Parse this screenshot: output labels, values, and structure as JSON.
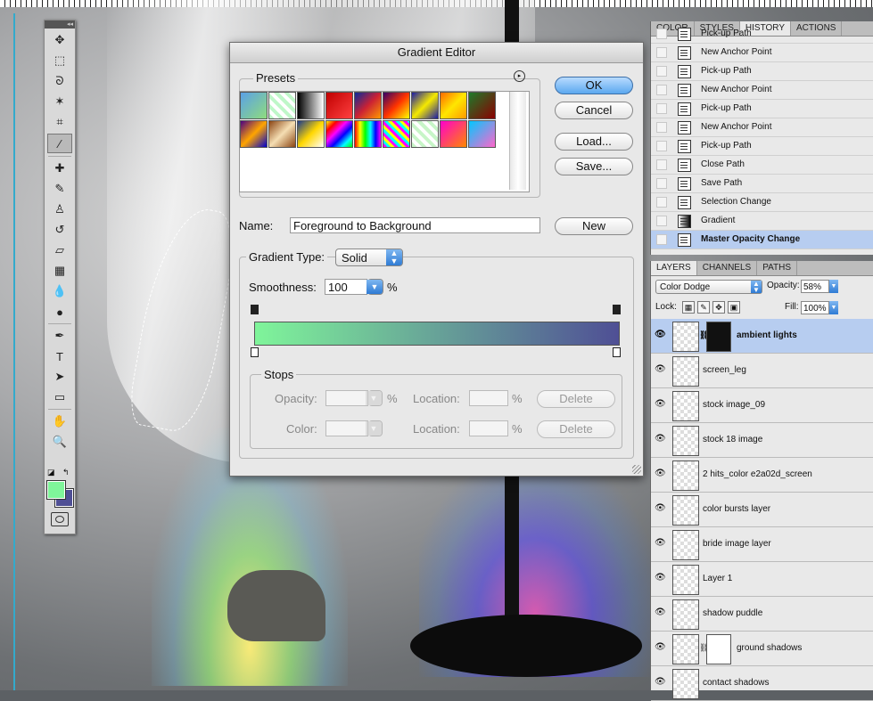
{
  "dialog": {
    "title": "Gradient Editor",
    "presets_label": "Presets",
    "ok": "OK",
    "cancel": "Cancel",
    "load": "Load...",
    "save": "Save...",
    "name_label": "Name:",
    "name_value": "Foreground to Background",
    "new": "New",
    "gradient_type_label": "Gradient Type:",
    "gradient_type_value": "Solid",
    "smoothness_label": "Smoothness:",
    "smoothness_value": "100",
    "percent": "%",
    "stops_label": "Stops",
    "opacity_label": "Opacity:",
    "location_label": "Location:",
    "color_label": "Color:",
    "delete": "Delete",
    "gradient_start": "#7ff59a",
    "gradient_end": "#4f4f95"
  },
  "presets": [
    "linear-gradient(135deg,#5aa0e6,#8fdc7e)",
    "repeating-linear-gradient(45deg,#bff7c9 0 4px,#fff 4px 8px)",
    "linear-gradient(90deg,#000,#fff)",
    "linear-gradient(135deg,#c00000,#ff4040)",
    "linear-gradient(135deg,#0a2a9a,#c23,#f90)",
    "linear-gradient(135deg,#330066,#f30,#ff0)",
    "linear-gradient(135deg,#1a1aa6,#f5e900,#1a1aa6)",
    "linear-gradient(135deg,#ff6a00,#ffe600,#ff9900)",
    "linear-gradient(135deg,#1e7a2a,#8b0000)",
    "linear-gradient(135deg,#4b0082,#ffa500,#0000cd)",
    "linear-gradient(135deg,#8b4513,#f5deb3,#8b4513)",
    "linear-gradient(135deg,#1b3a8a,#ffd700,#fff)",
    "linear-gradient(135deg,#ff0,#f00,#f0f,#00f,#0ff,#0f0)",
    "linear-gradient(90deg,#f00,#ff0,#0f0,#0ff,#00f,#f0f)",
    "repeating-linear-gradient(45deg,#f0f 0 3px,#0ff 3px 6px,#ff0 6px 9px)",
    "repeating-linear-gradient(45deg,#c8f5c8 0 4px,#fff 4px 8px)",
    "linear-gradient(135deg,#ff00cc,#ff8800)",
    "linear-gradient(135deg,#00c8ff,#ff66cc)"
  ],
  "panel_history": {
    "tabs": [
      "COLOR",
      "STYLES",
      "HISTORY",
      "ACTIONS"
    ],
    "active_tab": "HISTORY",
    "items": [
      {
        "label": "Pick-up Path"
      },
      {
        "label": "New Anchor Point"
      },
      {
        "label": "Pick-up Path"
      },
      {
        "label": "New Anchor Point"
      },
      {
        "label": "Pick-up Path"
      },
      {
        "label": "New Anchor Point"
      },
      {
        "label": "Pick-up Path"
      },
      {
        "label": "Close Path"
      },
      {
        "label": "Save Path"
      },
      {
        "label": "Selection Change"
      },
      {
        "label": "Gradient"
      },
      {
        "label": "Master Opacity Change"
      }
    ]
  },
  "panel_layers": {
    "tabs": [
      "LAYERS",
      "CHANNELS",
      "PATHS"
    ],
    "active_tab": "LAYERS",
    "blend_mode": "Color Dodge",
    "opacity_label": "Opacity:",
    "opacity_value": "58%",
    "lock_label": "Lock:",
    "fill_label": "Fill:",
    "fill_value": "100%",
    "layers": [
      {
        "name": "ambient lights",
        "mask": "dark",
        "selected": true
      },
      {
        "name": "screen_leg",
        "mask": "",
        "selected": false
      },
      {
        "name": "stock image_09",
        "mask": "",
        "selected": false
      },
      {
        "name": "stock 18 image",
        "mask": "",
        "selected": false
      },
      {
        "name": "2 hits_color e2a02d_screen",
        "mask": "",
        "selected": false
      },
      {
        "name": "color bursts layer",
        "mask": "",
        "selected": false
      },
      {
        "name": "bride image layer",
        "mask": "",
        "selected": false
      },
      {
        "name": "Layer 1",
        "mask": "",
        "selected": false
      },
      {
        "name": "shadow puddle",
        "mask": "",
        "selected": false
      },
      {
        "name": "ground shadows",
        "mask": "light",
        "selected": false
      },
      {
        "name": "contact shadows",
        "mask": "",
        "selected": false
      }
    ]
  },
  "tools": [
    {
      "name": "move-tool",
      "glyph": "✥"
    },
    {
      "name": "marquee-tool",
      "glyph": "⬚"
    },
    {
      "name": "lasso-tool",
      "glyph": "ᘐ"
    },
    {
      "name": "magic-wand-tool",
      "glyph": "✶"
    },
    {
      "name": "crop-tool",
      "glyph": "⌗"
    },
    {
      "name": "eyedropper-tool",
      "glyph": "⁄"
    },
    {
      "name": "healing-brush-tool",
      "glyph": "✚"
    },
    {
      "name": "brush-tool",
      "glyph": "✎"
    },
    {
      "name": "clone-stamp-tool",
      "glyph": "♙"
    },
    {
      "name": "history-brush-tool",
      "glyph": "↺"
    },
    {
      "name": "eraser-tool",
      "glyph": "▱"
    },
    {
      "name": "gradient-tool",
      "glyph": "▦"
    },
    {
      "name": "blur-tool",
      "glyph": "💧"
    },
    {
      "name": "dodge-tool",
      "glyph": "●"
    },
    {
      "name": "pen-tool",
      "glyph": "✒"
    },
    {
      "name": "type-tool",
      "glyph": "T"
    },
    {
      "name": "path-selection-tool",
      "glyph": "➤"
    },
    {
      "name": "shape-tool",
      "glyph": "▭"
    },
    {
      "name": "hand-tool",
      "glyph": "✋"
    },
    {
      "name": "zoom-tool",
      "glyph": "🔍"
    }
  ],
  "colors": {
    "foreground": "#7ff59a",
    "background": "#4f4f95"
  }
}
